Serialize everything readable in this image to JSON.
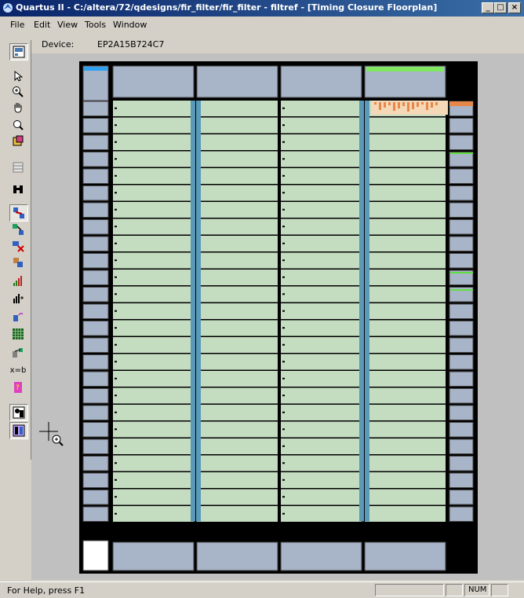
{
  "window": {
    "title": "Quartus II - C:/altera/72/qdesigns/fir_filter/fir_filter - filtref - [Timing Closure Floorplan]",
    "controls": {
      "minimize": "_",
      "restore": "□",
      "close": "×"
    }
  },
  "menu": [
    "File",
    "Edit",
    "View",
    "Tools",
    "Window"
  ],
  "device": {
    "label": "Device:",
    "value": "EP2A15B724C7"
  },
  "toolbar": {
    "icons": [
      "floorplan-view-icon",
      "selection-pointer-icon",
      "zoom-icon",
      "hand-pan-icon",
      "find-icon",
      "assignment-icon",
      "field-view-icon",
      "binoculars-icon",
      "show-routing-icon",
      "show-paths-icon",
      "delete-assignments-icon",
      "lock-icon",
      "show-slack-icon",
      "show-critical-path-icon",
      "fan-out-icon",
      "equation-icon",
      "grid-icon",
      "node-properties-icon",
      "equations-icon",
      "help-icon",
      "last-compilation-floorplan-icon",
      "current-assignments-floorplan-icon"
    ],
    "equation_label": "x=b"
  },
  "status": {
    "help_text": "For Help, press F1",
    "num": "NUM"
  },
  "colors": {
    "lab": "#c4dcc0",
    "io_block": "#a8b4c8",
    "esb_column": "#5a9ab8",
    "title_gradient_start": "#0a246a",
    "title_gradient_end": "#3a6ea5",
    "congestion": "#e88848"
  }
}
